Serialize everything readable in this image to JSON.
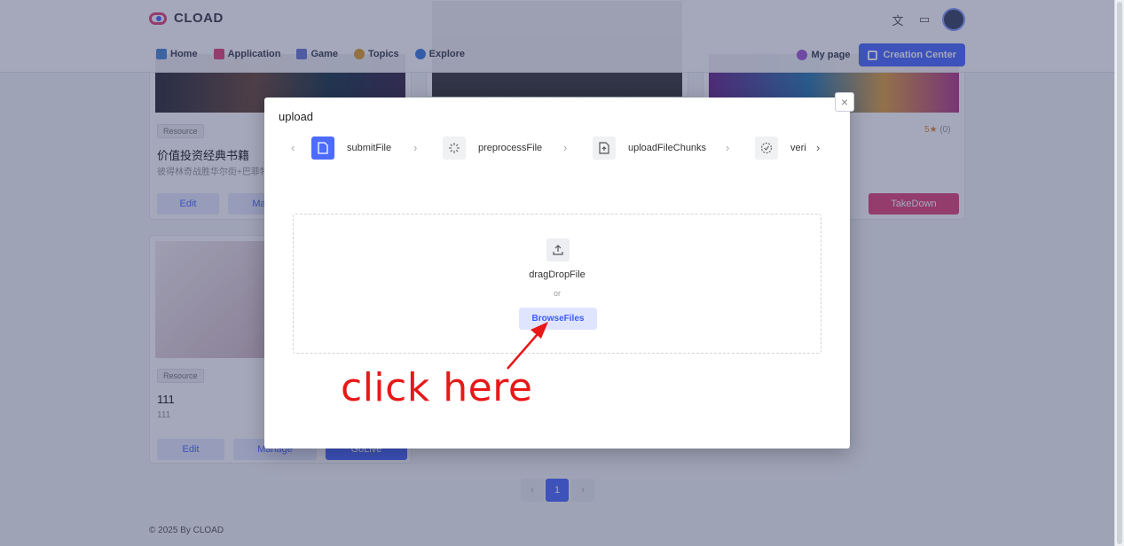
{
  "header": {
    "brand": "CLOAD",
    "nav": [
      {
        "label": "Home",
        "icon": "home-icon",
        "color": "#4d8bd6"
      },
      {
        "label": "Application",
        "icon": "app-grid-icon",
        "color": "#e2487a"
      },
      {
        "label": "Game",
        "icon": "gamepad-icon",
        "color": "#6b7bd6"
      },
      {
        "label": "Topics",
        "icon": "lightbulb-icon",
        "color": "#e0a030"
      },
      {
        "label": "Explore",
        "icon": "compass-icon",
        "color": "#3d7de0"
      }
    ],
    "my_page": "My page",
    "creation_center": "Creation Center"
  },
  "cards": [
    {
      "tag": "Resource",
      "title": "价值投资经典书籍",
      "subtitle": "彼得林奇战胜华尔街+巴菲特",
      "edit": "Edit",
      "manage": "Ma"
    },
    {
      "tag": "Resource",
      "title": "111",
      "subtitle": "111",
      "edit": "Edit",
      "manage": "Manage",
      "third": "GoLive"
    },
    {
      "rating": "5",
      "rating_count": "(0)",
      "takedown": "TakeDown"
    }
  ],
  "pagination": {
    "prev": "‹",
    "current": "1",
    "next": "›"
  },
  "footer": "© 2025 By CLOAD",
  "modal": {
    "title": "upload",
    "steps": [
      {
        "label": "submitFile",
        "icon": "file-icon"
      },
      {
        "label": "preprocessFile",
        "icon": "loading-icon"
      },
      {
        "label": "uploadFileChunks",
        "icon": "file-upload-icon"
      },
      {
        "label": "veri",
        "icon": "verify-icon"
      }
    ],
    "drop_text": "dragDropFile",
    "or_text": "or",
    "browse_label": "BrowseFiles"
  },
  "annotation": "click here",
  "colors": {
    "accent": "#4d6bff",
    "annotation": "#e81818",
    "danger": "#e2487a"
  }
}
